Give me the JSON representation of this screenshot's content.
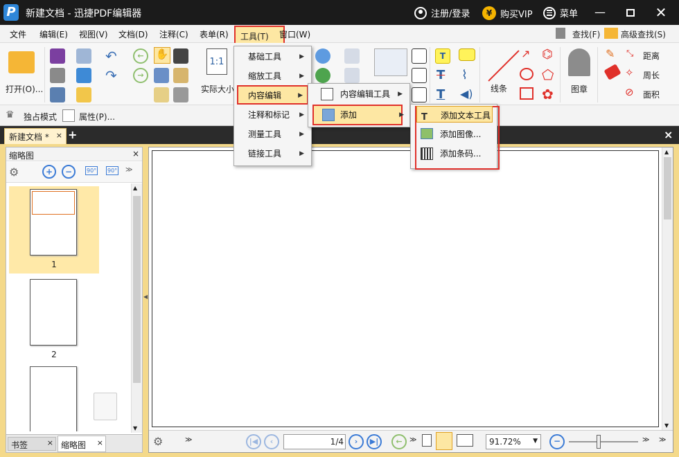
{
  "window": {
    "title": "新建文档 - 迅捷PDF编辑器",
    "logo_letter": "P"
  },
  "account": {
    "login_label": "注册/登录",
    "vip_label": "购买VIP",
    "vip_icon_text": "¥",
    "menu_label": "菜单"
  },
  "menubar": {
    "items": [
      "文件",
      "编辑(E)",
      "视图(V)",
      "文档(D)",
      "注释(C)",
      "表单(R)",
      "工具(T)",
      "窗口(W)"
    ]
  },
  "toolbar": {
    "open_label": "打开(O)...",
    "actual_size_label": "实际大小",
    "actual_size_icon": "1:1",
    "line_label": "线条",
    "stamp_label": "图章",
    "find_label": "查找(F)",
    "advanced_find_label": "高级查找(S)",
    "distance_label": "距离",
    "perimeter_label": "周长",
    "area_label": "面积",
    "exclusive_mode_label": "独占模式",
    "properties_label": "属性(P)..."
  },
  "tools_menu": {
    "items": [
      "基础工具",
      "缩放工具",
      "内容编辑",
      "注释和标记",
      "测量工具",
      "链接工具"
    ]
  },
  "content_edit_menu": {
    "items": [
      "内容编辑工具",
      "添加"
    ]
  },
  "add_menu": {
    "items": [
      "添加文本工具",
      "添加图像...",
      "添加条码..."
    ]
  },
  "tabs": {
    "document_tab": "新建文档 *",
    "add_tab": "+",
    "close": "×"
  },
  "thumbnails": {
    "title": "缩略图",
    "pages": [
      "1",
      "2"
    ],
    "rotate_left": "90°",
    "rotate_right": "90°"
  },
  "bottom_tabs": {
    "bookmarks": "书签",
    "thumbnails": "缩略图"
  },
  "status": {
    "page_indicator": "1",
    "page_total": "/4",
    "zoom": "91.72%"
  },
  "colors": {
    "accent": "#e0302a",
    "title_bg": "#1b1b1b",
    "workspace": "#f4d98a",
    "selected_thumb": "#ffe9a8"
  }
}
